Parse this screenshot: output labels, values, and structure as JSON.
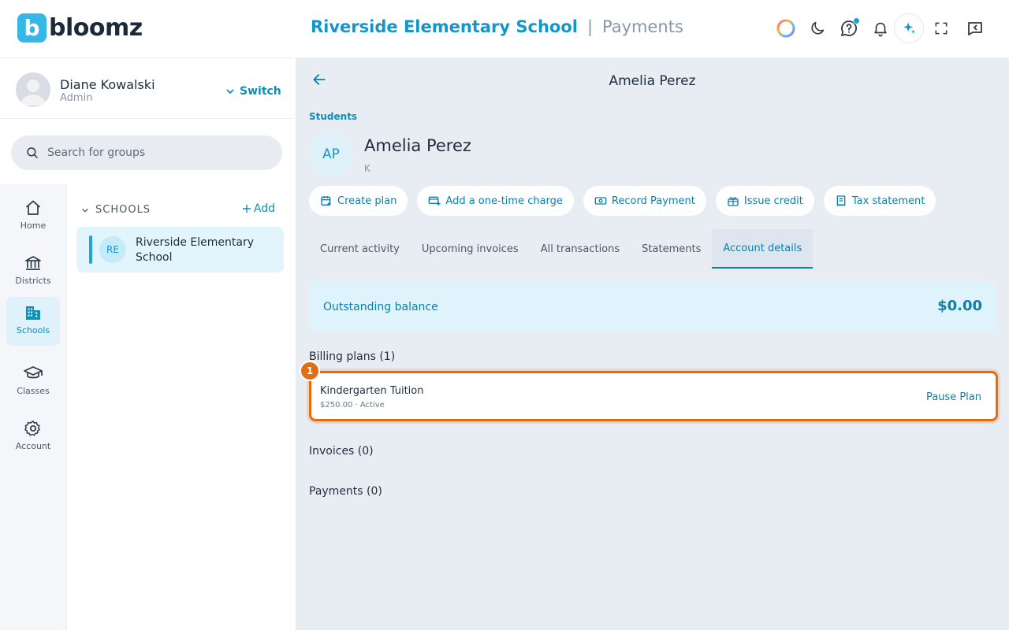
{
  "brand": {
    "logo_mark": "b",
    "logo_text": "bloomz"
  },
  "header": {
    "school": "Riverside Elementary School",
    "separator": "|",
    "section": "Payments",
    "icons": [
      "color-wheel-icon",
      "moon-icon",
      "help-chat-icon",
      "bell-icon",
      "sparkle-icon",
      "fullscreen-icon",
      "collapse-panel-icon"
    ]
  },
  "user": {
    "name": "Diane Kowalski",
    "role": "Admin",
    "switch_label": "Switch"
  },
  "search": {
    "placeholder": "Search for groups"
  },
  "nav": [
    {
      "label": "Home",
      "icon": "home-icon"
    },
    {
      "label": "Districts",
      "icon": "bank-icon"
    },
    {
      "label": "Schools",
      "icon": "building-icon",
      "active": true
    },
    {
      "label": "Classes",
      "icon": "graduation-cap-icon"
    },
    {
      "label": "Account",
      "icon": "gear-icon"
    }
  ],
  "groups": {
    "heading": "SCHOOLS",
    "add_label": "Add",
    "items": [
      {
        "initials": "RE",
        "name": "Riverside Elementary School"
      }
    ]
  },
  "page": {
    "title": "Amelia Perez"
  },
  "student": {
    "breadcrumb": "Students",
    "initials": "AP",
    "name": "Amelia Perez",
    "grade": "K"
  },
  "actions": [
    {
      "label": "Create plan",
      "icon": "calendar-plus-icon"
    },
    {
      "label": "Add a one-time charge",
      "icon": "card-plus-icon"
    },
    {
      "label": "Record Payment",
      "icon": "cash-icon"
    },
    {
      "label": "Issue credit",
      "icon": "gift-icon"
    },
    {
      "label": "Tax statement",
      "icon": "receipt-icon"
    }
  ],
  "tabs": [
    {
      "label": "Current activity"
    },
    {
      "label": "Upcoming invoices"
    },
    {
      "label": "All transactions"
    },
    {
      "label": "Statements"
    },
    {
      "label": "Account details",
      "active": true
    }
  ],
  "balance": {
    "label": "Outstanding balance",
    "amount": "$0.00"
  },
  "billing": {
    "heading": "Billing plans (1)",
    "plans": [
      {
        "name": "Kindergarten Tuition",
        "meta": "$250.00 · Active",
        "action": "Pause Plan"
      }
    ]
  },
  "invoices": {
    "heading": "Invoices (0)"
  },
  "payments": {
    "heading": "Payments (0)"
  },
  "annotation": {
    "marker": "1"
  },
  "colors": {
    "accent": "#0e8fb8",
    "highlight": "#e26d13",
    "balance_bg": "#def3fb"
  }
}
